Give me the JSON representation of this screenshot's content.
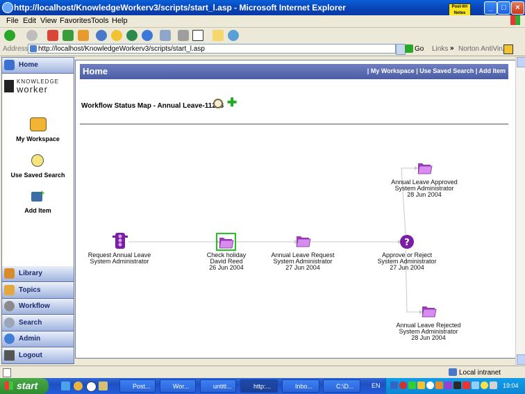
{
  "window": {
    "title": "http://localhost/KnowledgeWorkerv3/scripts/start_l.asp - Microsoft Internet Explorer",
    "postit_label": "Post-it® Notes"
  },
  "menu": [
    "File",
    "Edit",
    "View",
    "Favorites",
    "Tools",
    "Help"
  ],
  "address": {
    "label": "Address",
    "url": "http://localhost/KnowledgeWorkerv3/scripts/start_l.asp",
    "go": "Go",
    "links": "Links",
    "antivirus": "Norton AntiVirus"
  },
  "sidebar": {
    "home": "Home",
    "logo_top": "KNOWLEDGE",
    "logo_bottom": "worker",
    "items": [
      "My Workspace",
      "Use Saved Search",
      "Add Item"
    ],
    "sections": [
      "Library",
      "Topics",
      "Workflow",
      "Search",
      "Admin",
      "Logout"
    ]
  },
  "main": {
    "title": "Home",
    "links": [
      "My Workspace",
      "Use Saved Search",
      "Add Item"
    ],
    "workflow_title": "Workflow Status Map - Annual Leave-11228"
  },
  "workflow": {
    "nodes": [
      {
        "lines": [
          "Request Annual Leave",
          "System Administrator"
        ]
      },
      {
        "lines": [
          "Check holiday",
          "David Reed",
          "26 Jun 2004"
        ]
      },
      {
        "lines": [
          "Annual Leave Request",
          "System Administrator",
          "27 Jun 2004"
        ]
      },
      {
        "lines": [
          "Approve or Reject",
          "System Administrator",
          "27 Jun 2004"
        ]
      },
      {
        "lines": [
          "Annual Leave Approved",
          "System Administrator",
          "28 Jun 2004"
        ]
      },
      {
        "lines": [
          "Annual Leave Rejected",
          "System Administrator",
          "28 Jun 2004"
        ]
      }
    ]
  },
  "status": {
    "zone": "Local intranet"
  },
  "taskbar": {
    "start": "start",
    "tasks": [
      "Post...",
      "Wor...",
      "untitl...",
      "http:...",
      "Inbo...",
      "C:\\D..."
    ],
    "lang": "EN",
    "clock": "19:04"
  },
  "colors": {
    "titlebar": "#0842b4",
    "home_bar": "#5a6bb0",
    "folder": "#c86de0",
    "traffic_light": "#7a1fa3"
  }
}
